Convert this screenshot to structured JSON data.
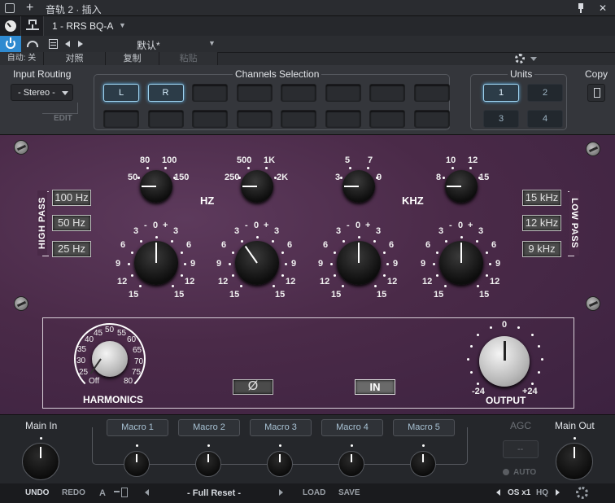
{
  "titlebar": {
    "plus_icon": "+",
    "title": "音轨 2 · 插入",
    "pin_icon": "▼",
    "close_icon": "✕"
  },
  "track": {
    "name": "1 - RRS BQ-A",
    "dropdown_icon": "▼"
  },
  "preset": {
    "name": "默认*",
    "dropdown_icon": "▼"
  },
  "edit": {
    "auto": "自动: 关",
    "compare": "对照",
    "copy": "复制",
    "paste": "粘贴"
  },
  "routing": {
    "label": "Input Routing",
    "value": "- Stereo -",
    "edit": "EDIT"
  },
  "channels": {
    "label": "Channels Selection",
    "buttons": [
      "L",
      "R"
    ]
  },
  "units": {
    "label": "Units",
    "buttons": [
      "1",
      "2",
      "3",
      "4"
    ]
  },
  "copy": {
    "label": "Copy"
  },
  "eq": {
    "hp_label": "HIGH PASS",
    "lp_label": "LOW PASS",
    "hp_buttons": [
      "100 Hz",
      "50 Hz",
      "25 Hz"
    ],
    "lp_buttons": [
      "15 kHz",
      "12 kHz",
      "9 kHz"
    ],
    "hz_label": "HZ",
    "khz_label": "KHZ",
    "freq1": [
      "50",
      "80",
      "100",
      "150"
    ],
    "freq2": [
      "250",
      "500",
      "1K",
      "2K"
    ],
    "freq3": [
      "3",
      "5",
      "7",
      "9"
    ],
    "freq4": [
      "8",
      "10",
      "12",
      "15"
    ],
    "gain_ticks": {
      "zero": "0",
      "minus": "-",
      "plus": "+",
      "three": "3",
      "six": "6",
      "nine": "9",
      "twelve": "12",
      "fifteen": "15"
    }
  },
  "harmonics": {
    "label": "HARMONICS",
    "ticks": [
      "Off",
      "25",
      "30",
      "35",
      "40",
      "45",
      "50",
      "55",
      "60",
      "65",
      "70",
      "75",
      "80"
    ]
  },
  "phase": {
    "label": "Ø"
  },
  "inbtn": {
    "label": "IN"
  },
  "output": {
    "label": "OUTPUT",
    "zero": "0",
    "min": "-24",
    "max": "+24"
  },
  "macro": {
    "main_in": "Main In",
    "main_out": "Main Out",
    "agc": "AGC",
    "agc_value": "--",
    "auto": "AUTO",
    "buttons": [
      "Macro 1",
      "Macro 2",
      "Macro 3",
      "Macro 4",
      "Macro 5"
    ]
  },
  "bottom": {
    "undo": "UNDO",
    "redo": "REDO",
    "a": "A",
    "preset": "- Full Reset -",
    "load": "LOAD",
    "save": "SAVE",
    "os": "OS x1",
    "hq": "HQ"
  }
}
